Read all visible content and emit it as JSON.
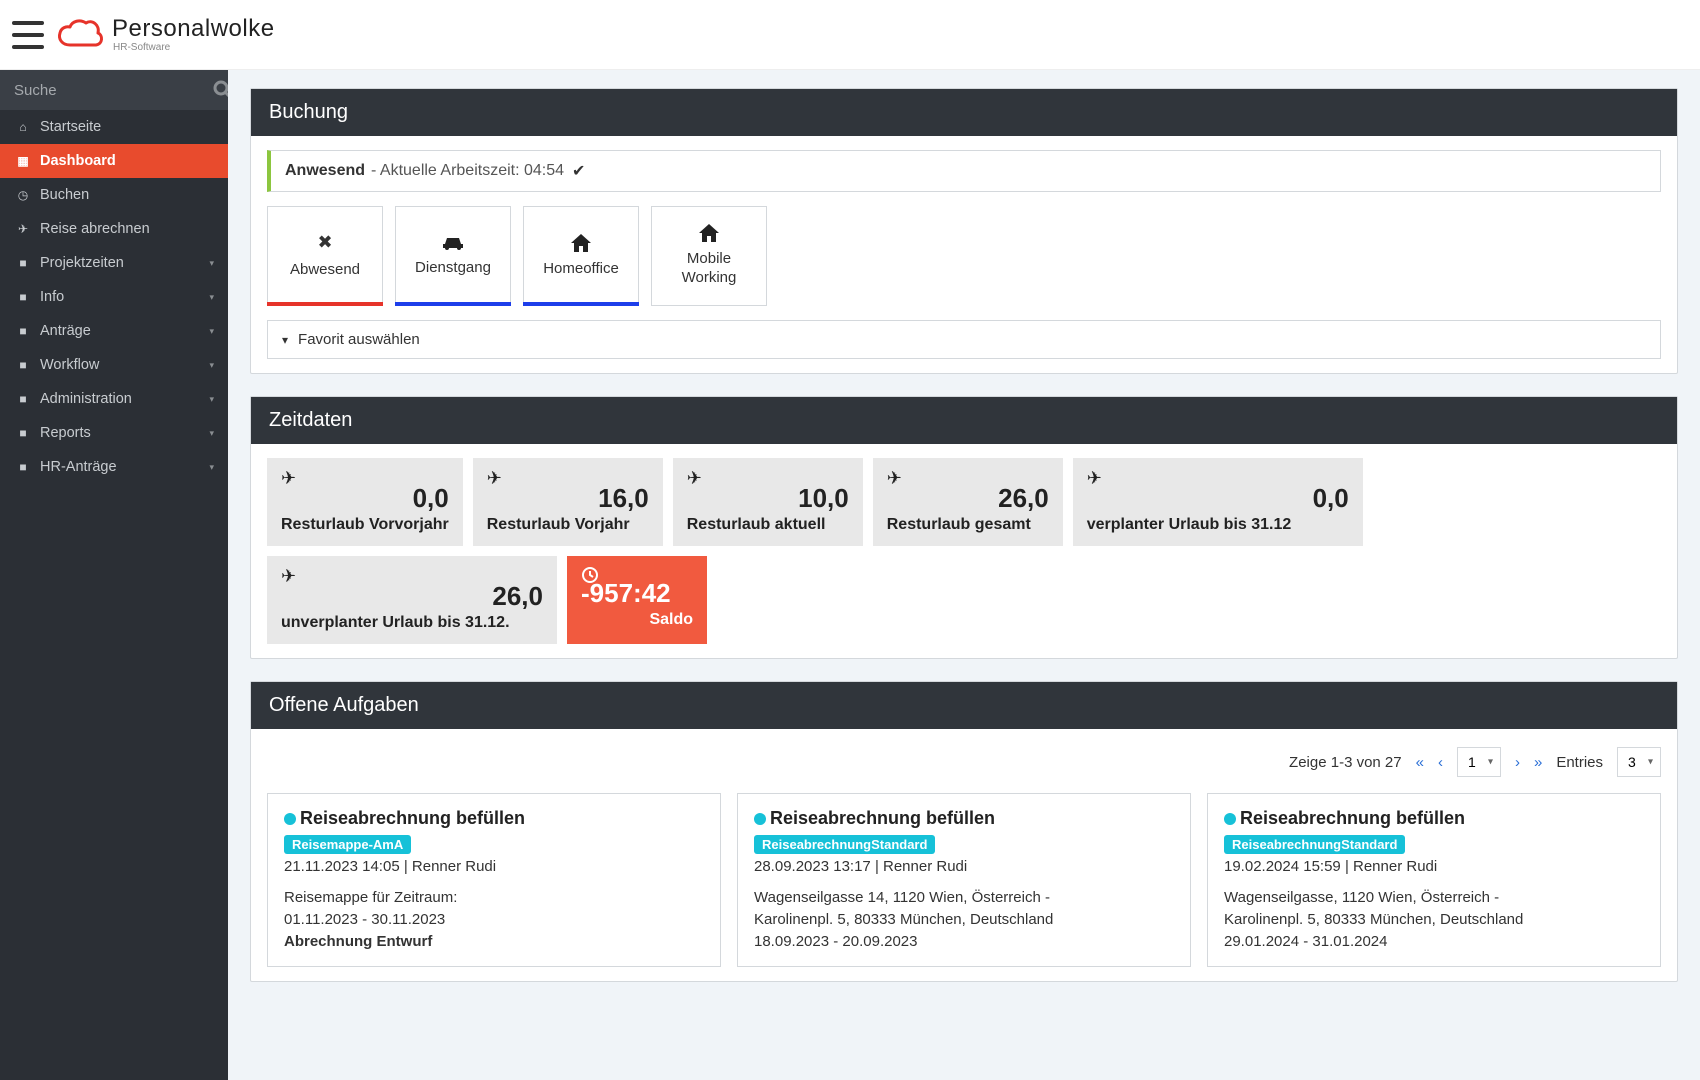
{
  "brand": {
    "name": "Personalwolke",
    "sub": "HR-Software"
  },
  "sidebar": {
    "search_placeholder": "Suche",
    "items": [
      {
        "label": "Startseite",
        "icon": "home",
        "expandable": false,
        "active": false
      },
      {
        "label": "Dashboard",
        "icon": "grid",
        "expandable": false,
        "active": true
      },
      {
        "label": "Buchen",
        "icon": "clock",
        "expandable": false,
        "active": false
      },
      {
        "label": "Reise abrechnen",
        "icon": "plane",
        "expandable": false,
        "active": false
      },
      {
        "label": "Projektzeiten",
        "icon": "folder",
        "expandable": true,
        "active": false
      },
      {
        "label": "Info",
        "icon": "folder",
        "expandable": true,
        "active": false
      },
      {
        "label": "Anträge",
        "icon": "folder",
        "expandable": true,
        "active": false
      },
      {
        "label": "Workflow",
        "icon": "folder",
        "expandable": true,
        "active": false
      },
      {
        "label": "Administration",
        "icon": "folder",
        "expandable": true,
        "active": false
      },
      {
        "label": "Reports",
        "icon": "folder",
        "expandable": true,
        "active": false
      },
      {
        "label": "HR-Anträge",
        "icon": "folder",
        "expandable": true,
        "active": false
      }
    ]
  },
  "buchung": {
    "header": "Buchung",
    "status_label": "Anwesend",
    "status_text": "- Aktuelle Arbeitszeit: 04:54",
    "tiles": [
      {
        "label": "Abwesend",
        "icon": "x",
        "underline": "red"
      },
      {
        "label": "Dienstgang",
        "icon": "car",
        "underline": "blue"
      },
      {
        "label": "Homeoffice",
        "icon": "house",
        "underline": "blue"
      },
      {
        "label": "Mobile Working",
        "icon": "house",
        "underline": ""
      }
    ],
    "favorit_label": "Favorit auswählen"
  },
  "zeitdaten": {
    "header": "Zeitdaten",
    "tiles": [
      {
        "icon": "plane",
        "value": "0,0",
        "label": "Resturlaub Vorvorjahr",
        "variant": "default"
      },
      {
        "icon": "plane",
        "value": "16,0",
        "label": "Resturlaub Vorjahr",
        "variant": "default"
      },
      {
        "icon": "plane",
        "value": "10,0",
        "label": "Resturlaub aktuell",
        "variant": "default"
      },
      {
        "icon": "plane",
        "value": "26,0",
        "label": "Resturlaub gesamt",
        "variant": "default"
      },
      {
        "icon": "plane",
        "value": "0,0",
        "label": "verplanter Urlaub bis 31.12",
        "variant": "big"
      },
      {
        "icon": "plane",
        "value": "26,0",
        "label": "unverplanter Urlaub bis 31.12.",
        "variant": "big"
      },
      {
        "icon": "clock",
        "value": "-957:42",
        "label": "Saldo",
        "variant": "saldo"
      }
    ]
  },
  "aufgaben": {
    "header": "Offene Aufgaben",
    "pager_text": "Zeige 1-3 von 27",
    "page_select": "1",
    "entries_label": "Entries",
    "entries_select": "3",
    "cards": [
      {
        "title": "Reiseabrechnung befüllen",
        "badge": "Reisemappe-AmA",
        "meta": "21.11.2023 14:05 | Renner Rudi",
        "line1": "Reisemappe für Zeitraum:",
        "line2": "01.11.2023 - 30.11.2023",
        "line3_bold": "Abrechnung Entwurf"
      },
      {
        "title": "Reiseabrechnung befüllen",
        "badge": "ReiseabrechnungStandard",
        "meta": "28.09.2023 13:17 | Renner Rudi",
        "line1": "Wagenseilgasse 14, 1120 Wien, Österreich -",
        "line2": "Karolinenpl. 5, 80333 München, Deutschland",
        "line3": "18.09.2023 - 20.09.2023"
      },
      {
        "title": "Reiseabrechnung befüllen",
        "badge": "ReiseabrechnungStandard",
        "meta": "19.02.2024 15:59 | Renner Rudi",
        "line1": "Wagenseilgasse, 1120 Wien, Österreich -",
        "line2": "Karolinenpl. 5, 80333 München, Deutschland",
        "line3": "29.01.2024 - 31.01.2024"
      }
    ]
  }
}
